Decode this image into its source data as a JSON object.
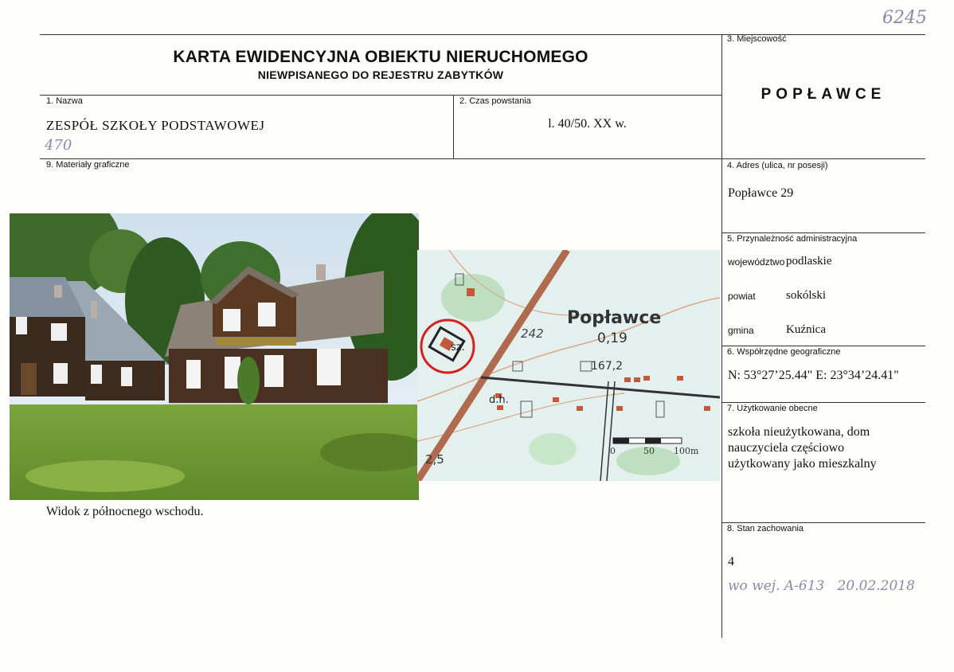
{
  "header": {
    "title": "KARTA EWIDENCYJNA OBIEKTU NIERUCHOMEGO",
    "subtitle": "NIEWPISANEGO DO REJESTRU ZABYTKÓW",
    "archive_number": "6245"
  },
  "fields": {
    "nazwa": {
      "label": "1. Nazwa",
      "value": "ZESPÓŁ  SZKOŁY  PODSTAWOWEJ",
      "handwritten": "470"
    },
    "czas_powstania": {
      "label": "2. Czas powstania",
      "value": "l. 40/50. XX w."
    },
    "miejscowosc": {
      "label": "3. Miejscowość",
      "value": "POPŁAWCE"
    },
    "adres": {
      "label": "4. Adres (ulica, nr posesji)",
      "value": "Popławce 29"
    },
    "przynaleznosc": {
      "label": "5. Przynależność administracyjna",
      "wojewodztwo_label": "województwo",
      "wojewodztwo": "podlaskie",
      "powiat_label": "powiat",
      "powiat": "sokólski",
      "gmina_label": "gmina",
      "gmina": "Kuźnica"
    },
    "wspolrzedne": {
      "label": "6. Współrzędne geograficzne",
      "value": "N: 53°27’25.44\" E: 23°34’24.41\""
    },
    "uzytkowanie": {
      "label": "7. Użytkowanie obecne",
      "line1": "szkoła nieużytkowana, dom",
      "line2": "nauczyciela częściowo",
      "line3": "użytkowany jako mieszkalny"
    },
    "stan": {
      "label": "8. Stan zachowania",
      "value": "4",
      "handwritten": "wo wej. A-613   20.02.2018"
    },
    "materialy": {
      "label": "9. Materiały graficzne",
      "caption": "Widok z północnego wschodu."
    }
  },
  "map": {
    "place_name": "Popławce",
    "area": "0,19",
    "elevation1": "242",
    "elevation2": "167,2",
    "label_sz": "sz.",
    "label_dh": "d.h.",
    "label_25": "2,5",
    "scale_0": "0",
    "scale_50": "50",
    "scale_100": "100m"
  },
  "colors": {
    "accent_road": "#b06a4e",
    "marker_red": "#d62020",
    "map_bg": "#e4f0ee",
    "sky": "#dde8f0",
    "grass": "#6f9b36"
  }
}
